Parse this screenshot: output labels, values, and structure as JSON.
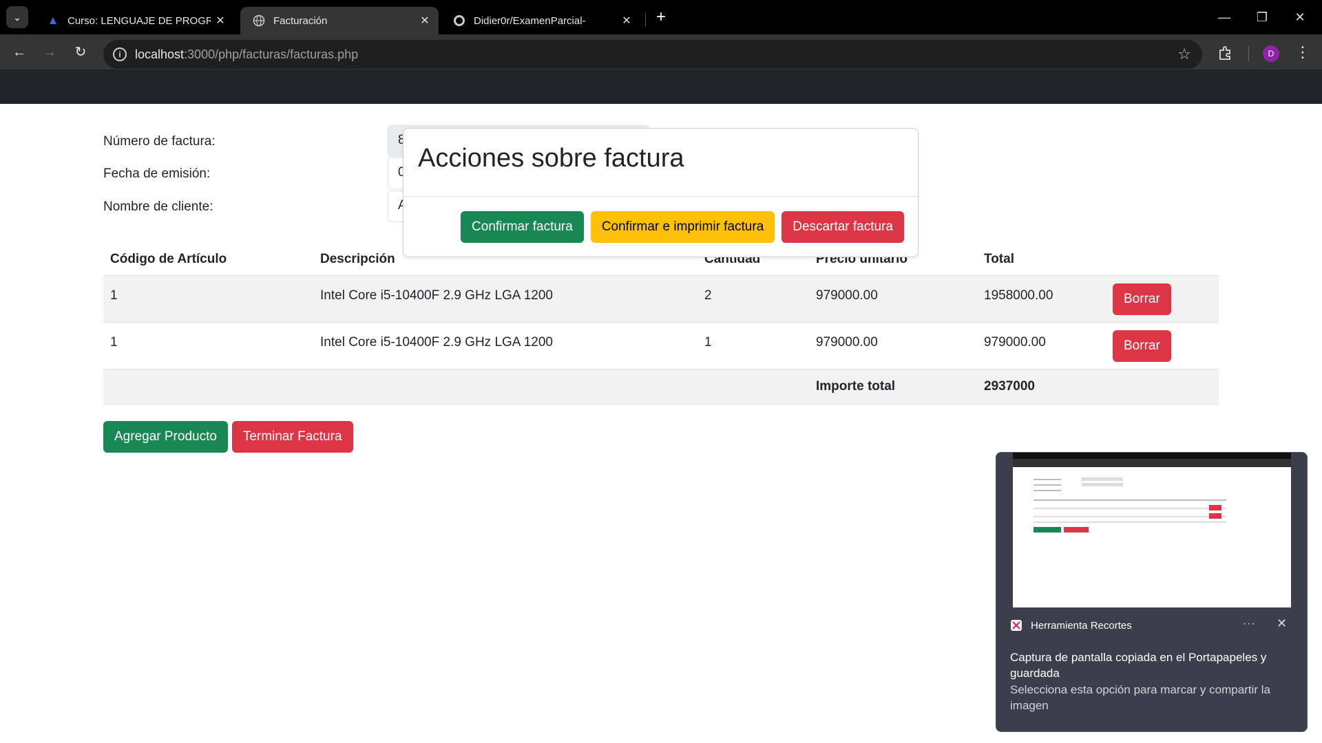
{
  "browser": {
    "tabs": [
      {
        "title": "Curso: LENGUAJE DE PROGRAMACI",
        "icon": "course-favicon"
      },
      {
        "title": "Facturación",
        "icon": "globe-icon",
        "active": true
      },
      {
        "title": "Didier0r/ExamenParcial-",
        "icon": "github-icon"
      }
    ],
    "url_host": "localhost",
    "url_rest": ":3000/php/facturas/facturas.php",
    "profile_initial": "D"
  },
  "form": {
    "invoice_number_label": "Número de factura:",
    "invoice_number_value": "8",
    "issue_date_label": "Fecha de emisión:",
    "issue_date_value": "0",
    "client_name_label": "Nombre de cliente:",
    "client_name_value": "A"
  },
  "table": {
    "headers": [
      "Código de Artículo",
      "Descripción",
      "Cantidad",
      "Precio unitario",
      "Total"
    ],
    "rows": [
      {
        "code": "1",
        "description": "Intel Core i5-10400F 2.9 GHz LGA 1200",
        "quantity": "2",
        "unit_price": "979000.00",
        "total": "1958000.00",
        "delete_label": "Borrar"
      },
      {
        "code": "1",
        "description": "Intel Core i5-10400F 2.9 GHz LGA 1200",
        "quantity": "1",
        "unit_price": "979000.00",
        "total": "979000.00",
        "delete_label": "Borrar"
      }
    ],
    "total_label": "Importe total",
    "total_value": "2937000"
  },
  "actions": {
    "add_product": "Agregar Producto",
    "finish_invoice": "Terminar Factura"
  },
  "modal": {
    "title": "Acciones sobre factura",
    "confirm": "Confirmar factura",
    "confirm_print": "Confirmar e imprimir factura",
    "discard": "Descartar factura"
  },
  "toast": {
    "app_name": "Herramienta Recortes",
    "heading": "Captura de pantalla copiada en el Portapapeles y guardada",
    "body": "Selecciona esta opción para marcar y compartir la imagen"
  },
  "colors": {
    "success": "#198754",
    "danger": "#dc3545",
    "warning": "#ffc107",
    "header_dark": "#212529"
  }
}
